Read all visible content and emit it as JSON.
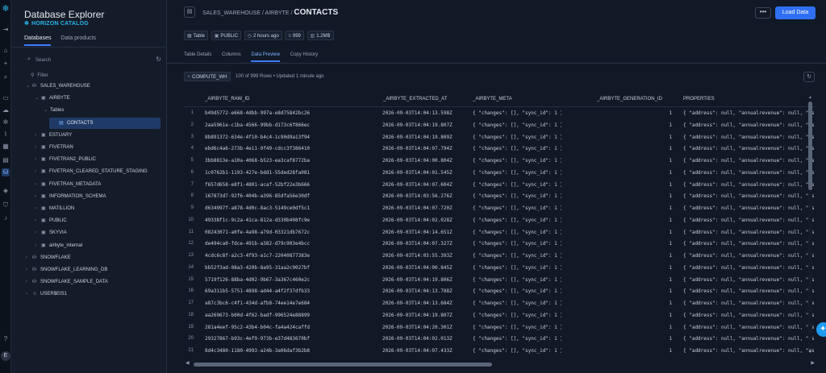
{
  "rail": {
    "icons": [
      "snowflake-logo",
      "collapse-icon",
      "home-icon",
      "plus-icon",
      "search-icon",
      "projects-icon",
      "data-icon",
      "ai-ml-icon",
      "monitoring-icon",
      "marketplace-icon",
      "governance-icon",
      "database-icon",
      "catalog-icon",
      "admin-icon",
      "notifications-icon",
      "help-icon"
    ],
    "avatar": "E"
  },
  "explorer": {
    "title": "Database Explorer",
    "subtitle": "HORIZON CATALOG",
    "tabs": [
      "Databases",
      "Data products"
    ],
    "search_placeholder": "Search",
    "filter_label": "Filter",
    "tree": [
      {
        "label": "SALES_WAREHOUSE",
        "level": 0,
        "icon": "database",
        "expanded": true
      },
      {
        "label": "AIRBYTE",
        "level": 1,
        "icon": "schema",
        "expanded": true
      },
      {
        "label": "Tables",
        "level": 2,
        "icon": "none",
        "expanded": true
      },
      {
        "label": "CONTACTS",
        "level": 3,
        "icon": "table",
        "selected": true
      },
      {
        "label": "ESTUARY",
        "level": 1,
        "icon": "schema"
      },
      {
        "label": "FIVETRAN",
        "level": 1,
        "icon": "schema"
      },
      {
        "label": "FIVETRAN2_PUBLIC",
        "level": 1,
        "icon": "schema"
      },
      {
        "label": "FIVETRAN_CLEARED_STATURE_STAGING",
        "level": 1,
        "icon": "schema"
      },
      {
        "label": "FIVETRAN_METADATA",
        "level": 1,
        "icon": "schema"
      },
      {
        "label": "INFORMATION_SCHEMA",
        "level": 1,
        "icon": "schema"
      },
      {
        "label": "MATILLION",
        "level": 1,
        "icon": "schema"
      },
      {
        "label": "PUBLIC",
        "level": 1,
        "icon": "schema"
      },
      {
        "label": "SKYVIA",
        "level": 1,
        "icon": "schema"
      },
      {
        "label": "airbyte_internal",
        "level": 1,
        "icon": "schema"
      },
      {
        "label": "SNOWFLAKE",
        "level": 0,
        "icon": "database"
      },
      {
        "label": "SNOWFLAKE_LEARNING_DB",
        "level": 0,
        "icon": "database"
      },
      {
        "label": "SNOWFLAKE_SAMPLE_DATA",
        "level": 0,
        "icon": "database"
      },
      {
        "label": "USER$EIS1",
        "level": 0,
        "icon": "user"
      }
    ]
  },
  "header": {
    "breadcrumb_prefix": "SALES_WAREHOUSE / AIRBYTE /",
    "title": "CONTACTS",
    "more_label": "•••",
    "load_button": "Load Data"
  },
  "meta": {
    "type": "Table",
    "schema": "PUBLIC",
    "age": "2 hours ago",
    "rows": "999",
    "size": "1.2MB"
  },
  "tabs": [
    "Table Details",
    "Columns",
    "Data Preview",
    "Copy History"
  ],
  "active_tab": "Data Preview",
  "toolbar": {
    "warehouse": "COMPUTE_WH",
    "rows_info": "100 of 999 Rows • Updated 1 minute ago"
  },
  "grid": {
    "columns": [
      "_AIRBYTE_RAW_ID",
      "_AIRBYTE_EXTRACTED_AT",
      "_AIRBYTE_META",
      "_AIRBYTE_GENERATION_ID",
      "PROPERTIES"
    ],
    "rows": [
      [
        "1",
        "b49d5772-e668-4dbb-997a-e8d75842bc26",
        "2026-09-03T14:04:13.598Z",
        "{   \"changes\": [],   \"sync_id\": 1 }",
        "1",
        "{   \"address\": null,   \"annualrevenue\": null,   \"as"
      ],
      [
        "2",
        "2aa5961e-c1ba-4566-99bb-d173c6f866ec",
        "2026-09-03T14:04:19.807Z",
        "{   \"changes\": [],   \"sync_id\": 1 }",
        "1",
        "{   \"address\": null,   \"annualrevenue\": null,   \"as"
      ],
      [
        "3",
        "8b891372-634e-4f10-b4c4-1c90d9a13f94",
        "2026-09-03T14:04:19.809Z",
        "{   \"changes\": [],   \"sync_id\": 1 }",
        "1",
        "{   \"address\": null,   \"annualrevenue\": null,   \"as"
      ],
      [
        "4",
        "ebd6c4a6-273b-4e11-9f49-cdcc3f386410",
        "2026-09-03T14:04:07.794Z",
        "{   \"changes\": [],   \"sync_id\": 1 }",
        "1",
        "{   \"address\": null,   \"annualrevenue\": null,   \"as"
      ],
      [
        "5",
        "3bb8813e-a10a-4068-b523-ea3caf8772ba",
        "2026-09-03T14:04:00.804Z",
        "{   \"changes\": [],   \"sync_id\": 1 }",
        "1",
        "{   \"address\": null,   \"annualrevenue\": null,   \"as"
      ],
      [
        "6",
        "1c0762b1-1193-427e-bdd1-55ded28fa081",
        "2026-09-03T14:04:01.545Z",
        "{   \"changes\": [],   \"sync_id\": 1 }",
        "1",
        "{   \"address\": null,   \"annualrevenue\": null,   \"as"
      ],
      [
        "7",
        "f657d658-e8f1-4801-acaf-52bf22e3b666",
        "2026-09-03T14:04:07.604Z",
        "{   \"changes\": [],   \"sync_id\": 1 }",
        "1",
        "{   \"address\": null,   \"annualrevenue\": null,   \"as"
      ],
      [
        "8",
        "167873d7-92f6-404b-a396-85dfa56e30df",
        "2026-09-03T14:03:56.276Z",
        "{   \"changes\": [],   \"sync_id\": 1 }",
        "1",
        "{   \"address\": null,   \"annualrevenue\": null,   \"as"
      ],
      [
        "9",
        "d634997f-a878-4d0c-8ac3-5149ce0df5c1",
        "2026-09-03T14:04:07.720Z",
        "{   \"changes\": [],   \"sync_id\": 1 }",
        "1",
        "{   \"address\": null,   \"annualrevenue\": null,   \"as"
      ],
      [
        "10",
        "49338f1c-9c2a-41ca-812a-d330b408fc9e",
        "2026-09-03T14:04:02.028Z",
        "{   \"changes\": [],   \"sync_id\": 1 }",
        "1",
        "{   \"address\": null,   \"annualrevenue\": null,   \"as"
      ],
      [
        "11",
        "08243071-a0fe-4a98-a79d-03321db7672c",
        "2026-09-03T14:04:14.651Z",
        "{   \"changes\": [],   \"sync_id\": 1 }",
        "1",
        "{   \"address\": null,   \"annualrevenue\": null,   \"as"
      ],
      [
        "12",
        "de494ca0-fdce-491b-a382-d79c903e4bcc",
        "2026-09-03T14:04:07.327Z",
        "{   \"changes\": [],   \"sync_id\": 1 }",
        "1",
        "{   \"address\": null,   \"annualrevenue\": null,   \"as"
      ],
      [
        "13",
        "4cdc6c8f-a2c3-4f93-a1c7-22040877383e",
        "2026-09-03T14:03:55.393Z",
        "{   \"changes\": [],   \"sync_id\": 1 }",
        "1",
        "{   \"address\": null,   \"annualrevenue\": null,   \"as"
      ],
      [
        "14",
        "bb52f3ad-08a3-420b-8a95-31aa2c9027bf",
        "2026-09-03T14:04:00.845Z",
        "{   \"changes\": [],   \"sync_id\": 1 }",
        "1",
        "{   \"address\": null,   \"annualrevenue\": null,   \"as"
      ],
      [
        "15",
        "5719f126-88ba-4d02-9b67-3a367c460e2c",
        "2026-09-03T14:04:19.806Z",
        "{   \"changes\": [],   \"sync_id\": 1 }",
        "1",
        "{   \"address\": null,   \"annualrevenue\": null,   \"as"
      ],
      [
        "16",
        "69a311b5-5751-4898-ad44-a4f2f37dfb33",
        "2026-09-03T14:04:13.788Z",
        "{   \"changes\": [],   \"sync_id\": 1 }",
        "1",
        "{   \"address\": null,   \"annualrevenue\": null,   \"as"
      ],
      [
        "17",
        "a87c3bc6-c4f1-434d-afb8-74ee14e7e684",
        "2026-09-03T14:04:13.684Z",
        "{   \"changes\": [],   \"sync_id\": 1 }",
        "1",
        "{   \"address\": null,   \"annualrevenue\": null,   \"as"
      ],
      [
        "18",
        "aa269673-b00d-4f62-badf-996524e88899",
        "2026-09-03T14:04:19.807Z",
        "{   \"changes\": [],   \"sync_id\": 1 }",
        "1",
        "{   \"address\": null,   \"annualrevenue\": null,   \"as"
      ],
      [
        "19",
        "281a4eef-95c2-43b4-b04c-fa4a424caffd",
        "2026-09-03T14:04:20.301Z",
        "{   \"changes\": [],   \"sync_id\": 1 }",
        "1",
        "{   \"address\": null,   \"annualrevenue\": null,   \"as"
      ],
      [
        "20",
        "29327867-b93c-4ef9-973b-e37d483670bf",
        "2026-09-03T14:04:02.013Z",
        "{   \"changes\": [],   \"sync_id\": 1 }",
        "1",
        "{   \"address\": null,   \"annualrevenue\": null,   \"as"
      ],
      [
        "21",
        "8d4c3480-1180-4993-a24b-3a06daf3b2b8",
        "2026-09-03T14:04:07.433Z",
        "{   \"changes\": [],   \"sync_id\": 1 }",
        "1",
        "{   \"address\": null,   \"annualrevenue\": null,   \"as"
      ]
    ]
  },
  "colors": {
    "accent": "#2f6ff2",
    "brand": "#29b5e8",
    "background": "#111826",
    "panel": "#141c29",
    "selected": "#1f3a66"
  }
}
